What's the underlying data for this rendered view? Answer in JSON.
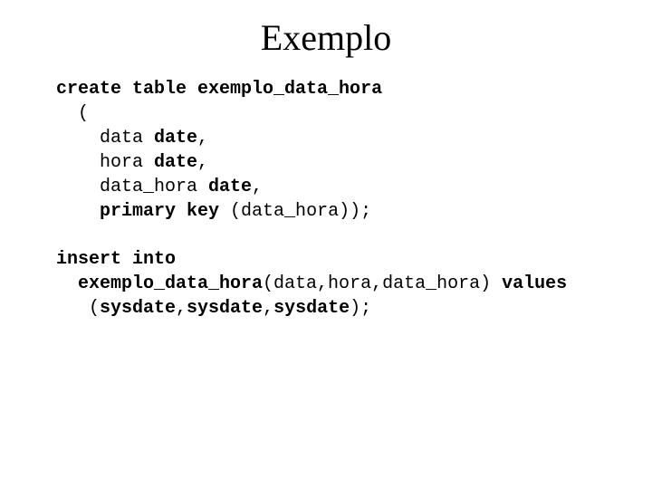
{
  "title": "Exemplo",
  "code": {
    "l1_kw": "create table",
    "l1_name": " exemplo_data_hora",
    "l2": "  (",
    "l3_pre": "    data ",
    "l3_kw": "date",
    "l3_post": ",",
    "l4_pre": "    hora ",
    "l4_kw": "date",
    "l4_post": ",",
    "l5_pre": "    data_hora ",
    "l5_kw": "date",
    "l5_post": ",",
    "l6_pre": "    ",
    "l6_kw": "primary key",
    "l6_post": " (data_hora));",
    "l7_kw": "insert into",
    "l8_name": "  exemplo_data_hora",
    "l8_args": "(data,hora,data_hora) ",
    "l8_kw": "values",
    "l9_pre": "   (",
    "l9_a": "sysdate",
    "l9_c1": ",",
    "l9_b": "sysdate",
    "l9_c2": ",",
    "l9_c": "sysdate",
    "l9_post": ");"
  }
}
